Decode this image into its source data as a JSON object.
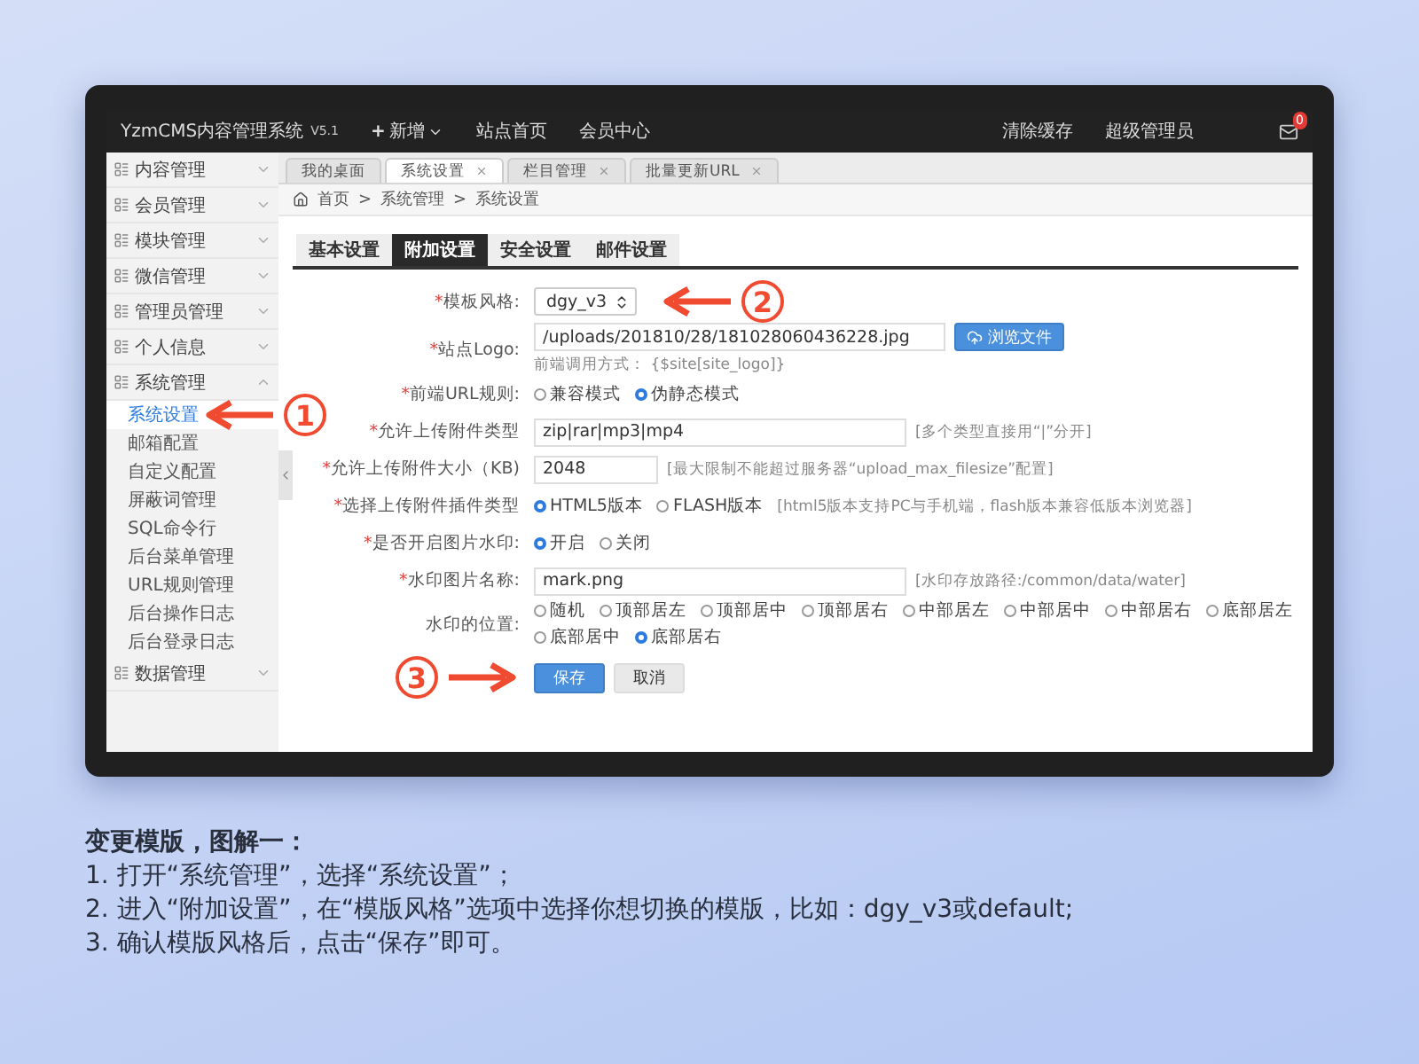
{
  "app": {
    "brand": "YzmCMS内容管理系统",
    "version": "V5.1",
    "plus": "+",
    "add_menu": "新增",
    "nav": [
      "站点首页",
      "会员中心"
    ],
    "right": [
      "清除缓存",
      "超级管理员"
    ],
    "mail_badge": "0"
  },
  "sidebar": {
    "items": [
      {
        "label": "内容管理",
        "expanded": false
      },
      {
        "label": "会员管理",
        "expanded": false
      },
      {
        "label": "模块管理",
        "expanded": false
      },
      {
        "label": "微信管理",
        "expanded": false
      },
      {
        "label": "管理员管理",
        "expanded": false
      },
      {
        "label": "个人信息",
        "expanded": false
      },
      {
        "label": "系统管理",
        "expanded": true,
        "children": [
          {
            "label": "系统设置",
            "selected": true,
            "step": "1"
          },
          {
            "label": "邮箱配置",
            "selected": false
          },
          {
            "label": "自定义配置",
            "selected": false
          },
          {
            "label": "屏蔽词管理",
            "selected": false
          },
          {
            "label": "SQL命令行",
            "selected": false
          },
          {
            "label": "后台菜单管理",
            "selected": false
          },
          {
            "label": "URL规则管理",
            "selected": false
          },
          {
            "label": "后台操作日志",
            "selected": false
          },
          {
            "label": "后台登录日志",
            "selected": false
          }
        ]
      },
      {
        "label": "数据管理",
        "expanded": false
      }
    ]
  },
  "tabs": [
    {
      "label": "我的桌面",
      "selected": false,
      "closable": false
    },
    {
      "label": "系统设置",
      "selected": true,
      "closable": true
    },
    {
      "label": "栏目管理",
      "selected": false,
      "closable": true
    },
    {
      "label": "批量更新URL",
      "selected": false,
      "closable": true
    }
  ],
  "breadcrumb": {
    "items": [
      "首页",
      "系统管理",
      "系统设置"
    ],
    "separator": ">"
  },
  "form_tabs": [
    {
      "label": "基本设置",
      "selected": false
    },
    {
      "label": "附加设置",
      "selected": true
    },
    {
      "label": "安全设置",
      "selected": false
    },
    {
      "label": "邮件设置",
      "selected": false
    }
  ],
  "form": {
    "rows": [
      {
        "kind": "select",
        "required": "*",
        "label": "模板风格:",
        "value": "dgy_v3",
        "step": "2"
      },
      {
        "kind": "file",
        "required": "*",
        "label": "站点Logo:",
        "value": "/uploads/201810/28/181028060436228.jpg",
        "button": "浏览文件",
        "hint": "前端调用方式：  {$site[site_logo]}"
      },
      {
        "kind": "radio",
        "required": "*",
        "label": "前端URL规则:",
        "options": [
          {
            "label": "兼容模式",
            "selected": false
          },
          {
            "label": "伪静态模式",
            "selected": true
          }
        ]
      },
      {
        "kind": "text",
        "required": "*",
        "label": "允许上传附件类型",
        "value": "zip|rar|mp3|mp4",
        "hint": "[多个类型直接用“|”分开]",
        "wide": true
      },
      {
        "kind": "text",
        "required": "*",
        "label": "允许上传附件大小（KB)",
        "value": "2048",
        "hint": "[最大限制不能超过服务器“upload_max_filesize”配置]",
        "wide": false
      },
      {
        "kind": "radio",
        "required": "*",
        "label": "选择上传附件插件类型",
        "options": [
          {
            "label": "HTML5版本",
            "selected": true
          },
          {
            "label": "FLASH版本",
            "selected": false
          }
        ],
        "hint": "[html5版本支持PC与手机端，flash版本兼容低版本浏览器]"
      },
      {
        "kind": "radio",
        "required": "*",
        "label": "是否开启图片水印:",
        "options": [
          {
            "label": "开启",
            "selected": true
          },
          {
            "label": "关闭",
            "selected": false
          }
        ]
      },
      {
        "kind": "text",
        "required": "*",
        "label": "水印图片名称:",
        "value": "mark.png",
        "hint": "[水印存放路径:/common/data/water]",
        "wide": true
      },
      {
        "kind": "radio",
        "label": "水印的位置:",
        "options": [
          {
            "label": "随机",
            "selected": false
          },
          {
            "label": "顶部居左",
            "selected": false
          },
          {
            "label": "顶部居中",
            "selected": false
          },
          {
            "label": "顶部居右",
            "selected": false
          },
          {
            "label": "中部居左",
            "selected": false
          },
          {
            "label": "中部居中",
            "selected": false
          },
          {
            "label": "中部居右",
            "selected": false
          },
          {
            "label": "底部居左",
            "selected": false
          },
          {
            "label": "底部居中",
            "selected": false
          },
          {
            "label": "底部居右",
            "selected": true
          }
        ]
      },
      {
        "kind": "buttons",
        "step": "3",
        "save": "保存",
        "cancel": "取消"
      }
    ]
  },
  "caption": {
    "title": "变更模版，图解一：",
    "lines": [
      "1. 打开“系统管理”，选择“系统设置”；",
      "2. 进入“附加设置”，在“模版风格”选项中选择你想切换的模版，比如：dgy_v3或default;",
      "3. 确认模版风格后，点击“保存”即可。"
    ]
  }
}
